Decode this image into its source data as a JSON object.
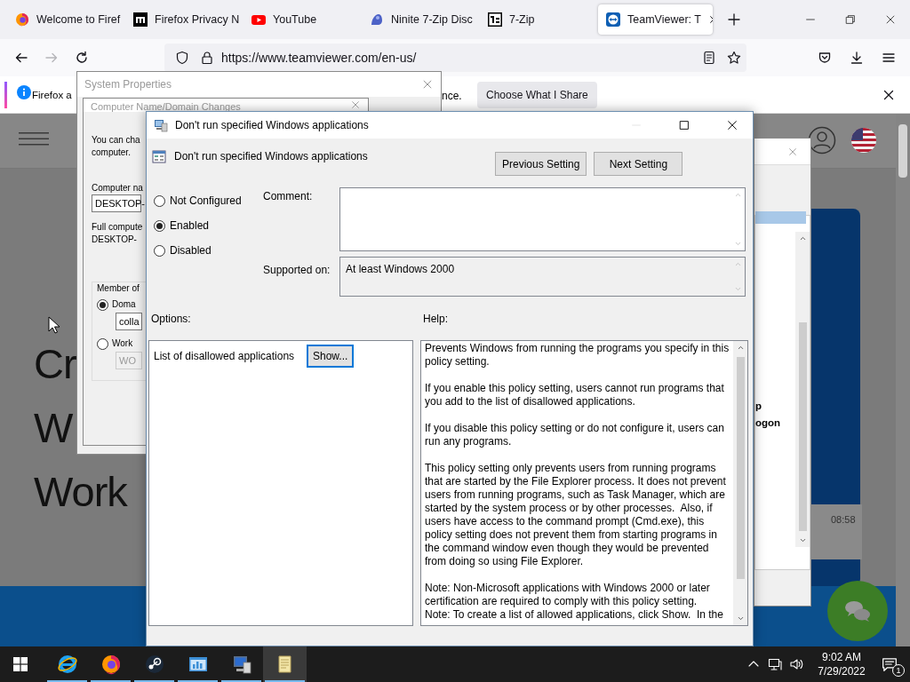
{
  "browser": {
    "tabs": [
      {
        "label": "Welcome to Firef",
        "kind": "firefox",
        "selected": false
      },
      {
        "label": "Firefox Privacy N",
        "kind": "mozilla",
        "selected": false
      },
      {
        "label": "YouTube",
        "kind": "youtube",
        "selected": false
      },
      {
        "label": "Ninite 7-Zip Disc",
        "kind": "ninite",
        "selected": false
      },
      {
        "label": "7-Zip",
        "kind": "sevenzip",
        "selected": false
      },
      {
        "label": "TeamViewer: T",
        "kind": "teamviewer",
        "selected": true
      }
    ],
    "nav_buttons": [
      {
        "kind": "back",
        "disabled": false
      },
      {
        "kind": "forward",
        "disabled": true
      },
      {
        "kind": "reload",
        "disabled": false
      }
    ],
    "url": "https://www.teamviewer.com/en-us/",
    "notification": {
      "text_left": "Firefox a",
      "text_right": "nce.",
      "button": "Choose What I Share"
    },
    "page": {
      "headline_lines": [
        "Cr",
        "W",
        "Work"
      ],
      "chat_time": "08:58"
    }
  },
  "system_properties": {
    "title": "System Properties"
  },
  "computer_name_window": {
    "title": "Computer Name/Domain Changes",
    "intro_lines": [
      "You can cha",
      "computer."
    ],
    "name_label": "Computer na",
    "name_value": "DESKTOP-",
    "full_name_label": "Full compute",
    "full_name_value": "DESKTOP-",
    "group_label": "Member of",
    "members": [
      {
        "label": "Doma",
        "selected": true,
        "value": "colla",
        "disabled": false
      },
      {
        "label": "Work",
        "selected": false,
        "value": "WO",
        "disabled": true
      }
    ]
  },
  "background_list_window": {
    "lines": [
      "p",
      "ogon"
    ]
  },
  "policy_dialog": {
    "title": "Don't run specified Windows applications",
    "title_buttons": [
      {
        "kind": "minimize",
        "disabled": true
      },
      {
        "kind": "maximize",
        "disabled": false
      },
      {
        "kind": "close",
        "disabled": false
      }
    ],
    "heading": "Don't run specified Windows applications",
    "nav_buttons": [
      "Previous Setting",
      "Next Setting"
    ],
    "states": [
      {
        "label": "Not Configured",
        "selected": false
      },
      {
        "label": "Enabled",
        "selected": true
      },
      {
        "label": "Disabled",
        "selected": false
      }
    ],
    "comment_label": "Comment:",
    "supported_label": "Supported on:",
    "supported_value": "At least Windows 2000",
    "options_label": "Options:",
    "help_label": "Help:",
    "options": [
      {
        "label": "List of disallowed applications",
        "button": "Show..."
      }
    ],
    "help_paragraphs": [
      [
        "Prevents Windows from running the programs you specify in this policy setting."
      ],
      [
        "If you enable this policy setting, users cannot run programs that you add to the list of disallowed applications."
      ],
      [
        "If you disable this policy setting or do not configure it, users can run any programs."
      ],
      [
        "This policy setting only prevents users from running programs that are started by the File Explorer process. It does not prevent users from running programs, such as Task Manager, which are started by the system process or by other processes.  Also, if users have access to the command prompt (Cmd.exe), this policy setting does not prevent them from starting programs in the command window even though they would be prevented from doing so using File Explorer."
      ],
      [
        "Note: Non-Microsoft applications with Windows 2000 or later certification are required to comply with this policy setting.",
        "Note: To create a list of allowed applications, click Show.  In the"
      ]
    ]
  },
  "taskbar": {
    "apps": [
      {
        "kind": "ie",
        "running": true,
        "selected": false
      },
      {
        "kind": "firefox",
        "running": true,
        "selected": false
      },
      {
        "kind": "steam",
        "running": true,
        "selected": false
      },
      {
        "kind": "control-panel",
        "running": true,
        "selected": false
      },
      {
        "kind": "system",
        "running": true,
        "selected": false
      },
      {
        "kind": "notepad",
        "running": true,
        "selected": true
      }
    ],
    "time": "9:02 AM",
    "date": "7/29/2022",
    "notifications": "1"
  }
}
